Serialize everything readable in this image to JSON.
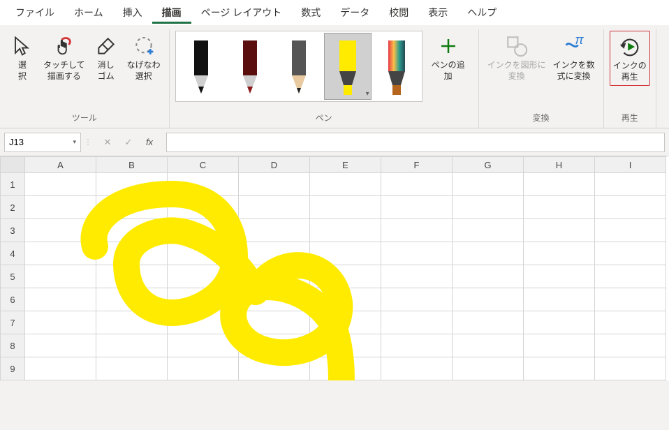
{
  "menu": {
    "file": "ファイル",
    "home": "ホーム",
    "insert": "挿入",
    "draw": "描画",
    "page_layout": "ページ レイアウト",
    "formulas": "数式",
    "data": "データ",
    "review": "校閲",
    "view": "表示",
    "help": "ヘルプ"
  },
  "ribbon": {
    "tools": {
      "label": "ツール",
      "select": "選\n択",
      "touch_draw": "タッチして\n描画する",
      "eraser": "消し\nゴム",
      "lasso": "なげなわ\n選択"
    },
    "pens": {
      "label": "ペン",
      "add_pen": "ペンの追\n加"
    },
    "convert": {
      "label": "変換",
      "ink_to_shape": "インクを図形に\n変換",
      "ink_to_math": "インクを数\n式に変換"
    },
    "replay": {
      "label": "再生",
      "ink_replay": "インクの\n再生"
    }
  },
  "formula_bar": {
    "cell_ref": "J13",
    "fx": "fx",
    "value": ""
  },
  "sheet": {
    "columns": [
      "A",
      "B",
      "C",
      "D",
      "E",
      "F",
      "G",
      "H",
      "I"
    ],
    "rows": [
      "1",
      "2",
      "3",
      "4",
      "5",
      "6",
      "7",
      "8",
      "9"
    ]
  },
  "colors": {
    "highlighter": "#FFEB00",
    "highlight_border": "#d13438"
  }
}
